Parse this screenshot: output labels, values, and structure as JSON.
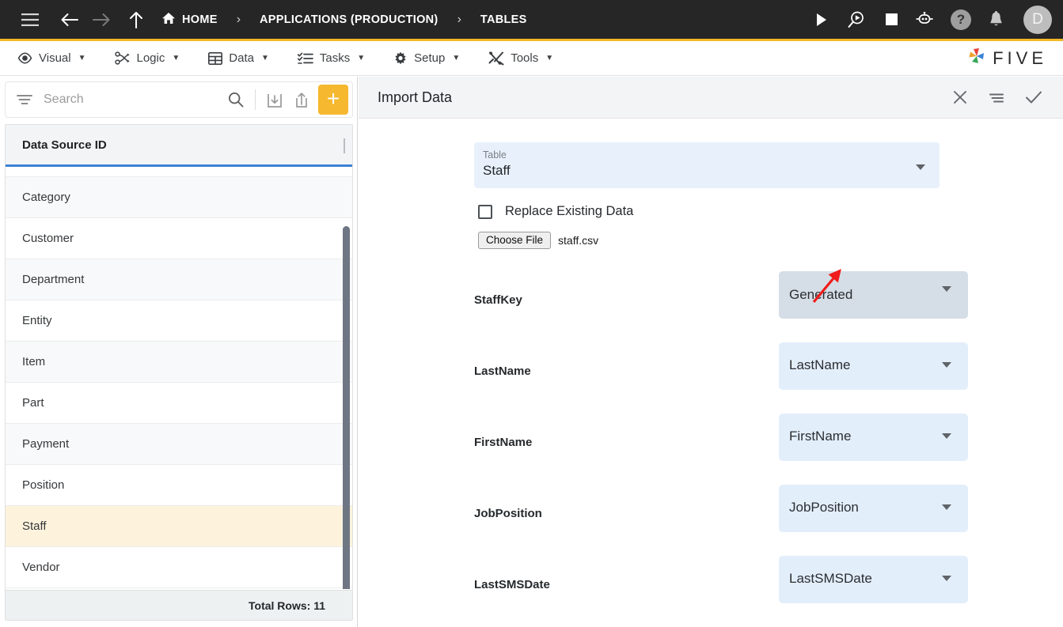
{
  "topbar": {
    "menu_icon": "hamburger-icon",
    "back_icon": "arrow-left-icon",
    "forward_icon": "arrow-right-icon",
    "up_icon": "arrow-up-icon",
    "breadcrumbs": [
      {
        "label": "HOME",
        "icon": "home-icon"
      },
      {
        "label": "APPLICATIONS (PRODUCTION)",
        "icon": ""
      },
      {
        "label": "TABLES",
        "icon": ""
      }
    ],
    "separator": "›",
    "actions": [
      {
        "name": "run-icon",
        "glyph": "play"
      },
      {
        "name": "debug-icon",
        "glyph": "magnifier-play"
      },
      {
        "name": "stop-icon",
        "glyph": "square"
      },
      {
        "name": "chatbot-icon",
        "glyph": "robot"
      },
      {
        "name": "help-icon",
        "glyph": "?"
      },
      {
        "name": "notifications-icon",
        "glyph": "bell"
      }
    ],
    "avatar_initial": "D",
    "accent_color": "#f2b827",
    "bar_color": "#262626"
  },
  "menubar": {
    "items": [
      {
        "label": "Visual",
        "icon": "eye-icon"
      },
      {
        "label": "Logic",
        "icon": "flow-icon"
      },
      {
        "label": "Data",
        "icon": "table-icon"
      },
      {
        "label": "Tasks",
        "icon": "checklist-icon"
      },
      {
        "label": "Setup",
        "icon": "gear-icon"
      },
      {
        "label": "Tools",
        "icon": "tools-icon"
      }
    ],
    "caret": "▼",
    "brand": "FIVE"
  },
  "sidebar": {
    "search": {
      "placeholder": "Search",
      "value": ""
    },
    "toolbar": {
      "filter_icon": "filter-icon",
      "search_icon": "search-icon",
      "import_icon": "import-icon",
      "export_icon": "export-icon",
      "add_label": "+"
    },
    "grid": {
      "column_header": "Data Source ID",
      "rows": [
        "Category",
        "Customer",
        "Department",
        "Entity",
        "Item",
        "Part",
        "Payment",
        "Position",
        "Staff",
        "Vendor"
      ],
      "selected_row": "Staff",
      "footer": "Total Rows: 11"
    }
  },
  "panel": {
    "title": "Import Data",
    "actions": [
      {
        "name": "close-icon",
        "glyph": "✕"
      },
      {
        "name": "list-menu-icon",
        "glyph": "lines"
      },
      {
        "name": "confirm-check-icon",
        "glyph": "✓"
      }
    ],
    "table_select": {
      "label": "Table",
      "value": "Staff"
    },
    "replace_checkbox": {
      "label": "Replace Existing Data",
      "checked": false
    },
    "file_picker": {
      "button_label": "Choose File",
      "file_name": "staff.csv"
    },
    "field_mappings": [
      {
        "field": "StaffKey",
        "value": "Generated",
        "focused": true
      },
      {
        "field": "LastName",
        "value": "LastName",
        "focused": false
      },
      {
        "field": "FirstName",
        "value": "FirstName",
        "focused": false
      },
      {
        "field": "JobPosition",
        "value": "JobPosition",
        "focused": false
      },
      {
        "field": "LastSMSDate",
        "value": "LastSMSDate",
        "focused": false
      }
    ],
    "annotation": {
      "type": "arrow",
      "color": "#f01c1c",
      "points_to": "staffkey-dropdown-caret"
    }
  }
}
